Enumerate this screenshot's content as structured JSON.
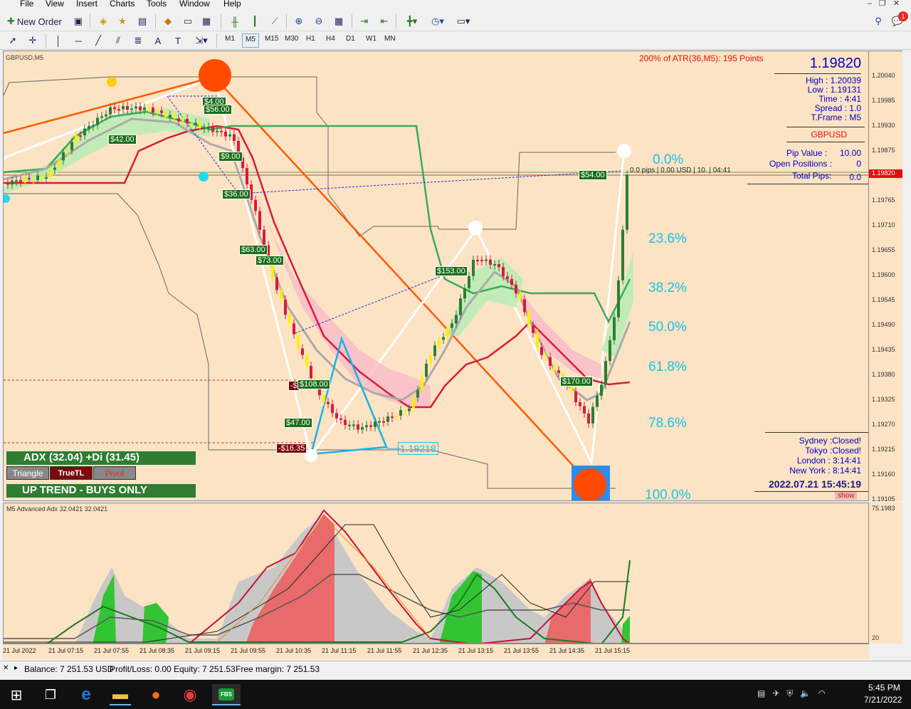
{
  "menu": [
    "File",
    "View",
    "Insert",
    "Charts",
    "Tools",
    "Window",
    "Help"
  ],
  "toolbar": {
    "new_order": "New Order"
  },
  "timeframes": [
    "M1",
    "M5",
    "M15",
    "M30",
    "H1",
    "H4",
    "D1",
    "W1",
    "MN"
  ],
  "active_timeframe": "M5",
  "chart": {
    "symbol_label": "GBPUSD,M5",
    "atr_text": "200% of ATR(36,M5):  195  Points",
    "current_price": "1.19820",
    "info": {
      "high": "High : 1.20039",
      "low": "Low : 1.19131",
      "time": "Time :     4:41",
      "spread": "Spread :      1.0",
      "tframe": "T.Frame :      M5",
      "symbol": "GBPUSD",
      "pip_value_label": "Pip Value :",
      "pip_value": "10.00",
      "open_positions_label": "Open Positions :",
      "open_positions": "0",
      "total_pips_label": "Total Pips:",
      "total_pips": "0.0"
    },
    "sessions": {
      "sydney": "Sydney :Closed!",
      "tokyo": "Tokyo :Closed!",
      "london": "London : 3:14:41",
      "newyork": "New York : 8:14:41"
    },
    "datetime": "2022.07.21 15:45:19",
    "show_btn": "show",
    "pips_line_text": "0.0 pips | 0.00 USD | 10. | 04:41",
    "price_label_line": "1.19218",
    "fib_levels": [
      "0.0%",
      "23.6%",
      "38.2%",
      "50.0%",
      "61.8%",
      "78.6%",
      "100.0%"
    ],
    "profit_labels": [
      "$4.00",
      "$56.00",
      "$42.00",
      "$9.00",
      "$36.00",
      "$63.00",
      "$73.00",
      "$108.00",
      "$47.00",
      "$153.00",
      "$54.00",
      "$170.00"
    ],
    "loss_labels": [
      "-$",
      "-$16.35"
    ],
    "adx_panel": "ADX (32.04)    +Di (31.45)",
    "btn_triangle": "Triangle",
    "btn_truetl": "TrueTL",
    "btn_pivot": "Pivot",
    "trend_panel": "UP TREND - BUYS ONLY"
  },
  "price_ticks": [
    "1.20040",
    "1.19985",
    "1.19930",
    "1.19875",
    "1.19820",
    "1.19765",
    "1.19710",
    "1.19655",
    "1.19600",
    "1.19545",
    "1.19490",
    "1.19435",
    "1.19380",
    "1.19325",
    "1.19270",
    "1.19215",
    "1.19160",
    "1.19105"
  ],
  "bid_tag": "1.19820",
  "indicator": {
    "label": "M5 Advanced Adx 32.0421 32.0421",
    "scale_top": "75.1983",
    "scale_bottom": "20"
  },
  "time_labels": [
    "21 Jul 2022",
    "21 Jul 07:15",
    "21 Jul 07:55",
    "21 Jul 08:35",
    "21 Jul 09:15",
    "21 Jul 09:55",
    "21 Jul 10:35",
    "21 Jul 11:15",
    "21 Jul 11:55",
    "21 Jul 12:35",
    "21 Jul 13:15",
    "21 Jul 13:55",
    "21 Jul 14:35",
    "21 Jul 15:15"
  ],
  "status": {
    "balance": "Balance: 7 251.53 USD",
    "profit": "Profit/Loss: 0.00",
    "equity": "Equity: 7 251.53",
    "free_margin": "Free margin: 7 251.53"
  },
  "taskbar": {
    "time": "5:45 PM",
    "date": "7/21/2022",
    "fbs_label": "FBS",
    "notification_count": "1"
  },
  "colors": {
    "chart_bg": "#fce3c4",
    "bull": "#2e7d32",
    "bear": "#d81b3b",
    "doji": "#ffee00",
    "fib": "#17c3e8",
    "trendline": "#ff5a00"
  }
}
